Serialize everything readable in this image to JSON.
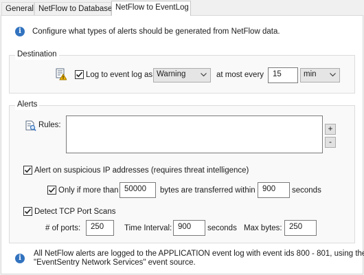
{
  "tabs": [
    {
      "label": "General",
      "active": false
    },
    {
      "label": "NetFlow to Database",
      "active": false
    },
    {
      "label": "NetFlow to EventLog",
      "active": true
    }
  ],
  "intro_text": "Configure what types of alerts should be generated from NetFlow data.",
  "destination": {
    "title": "Destination",
    "log_checkbox_checked": true,
    "log_label": "Log to event log as",
    "severity_value": "Warning",
    "at_most_label": "at most every",
    "interval_value": "15",
    "unit_value": "min"
  },
  "alerts": {
    "title": "Alerts",
    "rules_label": "Rules:",
    "add_label": "+",
    "remove_label": "-",
    "suspicious_ip": {
      "checked": true,
      "label": "Alert on suspicious IP addresses (requires threat intelligence)"
    },
    "only_if": {
      "checked": true,
      "label": "Only if more than",
      "bytes_value": "50000",
      "bytes_label": "bytes are transferred within",
      "seconds_value": "900",
      "seconds_label": "seconds"
    },
    "tcp_scan": {
      "checked": true,
      "label": "Detect TCP Port Scans",
      "ports_label": "# of ports:",
      "ports_value": "250",
      "interval_label": "Time Interval:",
      "interval_value": "900",
      "interval_unit": "seconds",
      "max_bytes_label": "Max bytes:",
      "max_bytes_value": "250"
    }
  },
  "footer_text_line1": "All NetFlow alerts are logged to the APPLICATION event log with event ids 800 - 801, using the",
  "footer_text_line2": "\"EventSentry Network Services\" event source.",
  "colors": {
    "info_blue": "#3273bf",
    "group_background": "#f9f9f9",
    "panel_background": "#ffffff",
    "window_background": "#f0f0f0"
  },
  "icons": [
    "info-icon",
    "event-log-warning-icon",
    "rules-document-icon",
    "checkmark-icon",
    "chevron-down-icon"
  ]
}
